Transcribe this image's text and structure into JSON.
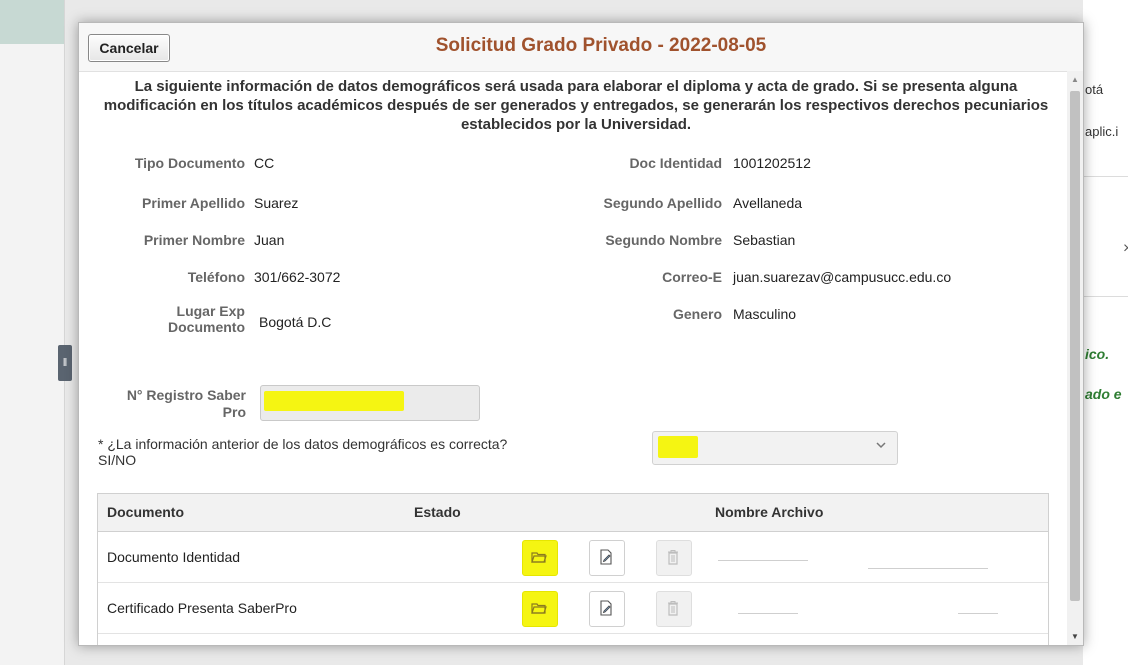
{
  "background": {
    "right_partial_texts": [
      "otá",
      "aplic.i",
      "ico.",
      "ado e"
    ],
    "right_close_glyph": "×"
  },
  "dialog": {
    "cancel_label": "Cancelar",
    "title": "Solicitud Grado Privado - 2022-08-05",
    "notice": "La siguiente información de datos demográficos será usada para elaborar el diploma y acta de grado. Si se presenta alguna modificación en los títulos académicos después de ser generados y entregados, se generarán los respectivos derechos pecuniarios establecidos por la Universidad."
  },
  "fields": {
    "tipo_documento": {
      "label": "Tipo Documento",
      "value": "CC"
    },
    "doc_identidad": {
      "label": "Doc Identidad",
      "value": "1001202512"
    },
    "primer_apellido": {
      "label": "Primer Apellido",
      "value": "Suarez"
    },
    "segundo_apellido": {
      "label": "Segundo Apellido",
      "value": "Avellaneda"
    },
    "primer_nombre": {
      "label": "Primer Nombre",
      "value": "Juan"
    },
    "segundo_nombre": {
      "label": "Segundo Nombre",
      "value": "Sebastian"
    },
    "telefono": {
      "label": "Teléfono",
      "value": "301/662-3072"
    },
    "correo": {
      "label": "Correo-E",
      "value": "juan.suarezav@campusucc.edu.co"
    },
    "lugar_exp": {
      "label_line1": "Lugar Exp",
      "label_line2": "Documento",
      "value": "Bogotá D.C"
    },
    "genero": {
      "label": "Genero",
      "value": "Masculino"
    },
    "saber_pro": {
      "label_line1": "N° Registro Saber",
      "label_line2": "Pro",
      "value": ""
    }
  },
  "question": {
    "required_mark": "*",
    "text": "¿La información anterior de los datos demográficos es correcta? SI/NO",
    "selected": ""
  },
  "table": {
    "headers": {
      "documento": "Documento",
      "estado": "Estado",
      "nombre_archivo": "Nombre Archivo"
    },
    "rows": [
      {
        "documento": "Documento Identidad",
        "estado": ""
      },
      {
        "documento": "Certificado Presenta SaberPro",
        "estado": ""
      }
    ]
  },
  "icons": {
    "open": "folder-open-icon",
    "edit": "document-edit-icon",
    "delete": "trash-icon",
    "select": "chevron-down-icon"
  },
  "colors": {
    "title": "#a0522d",
    "highlight": "#f5f512",
    "background_accent": "#c7d9d3"
  }
}
